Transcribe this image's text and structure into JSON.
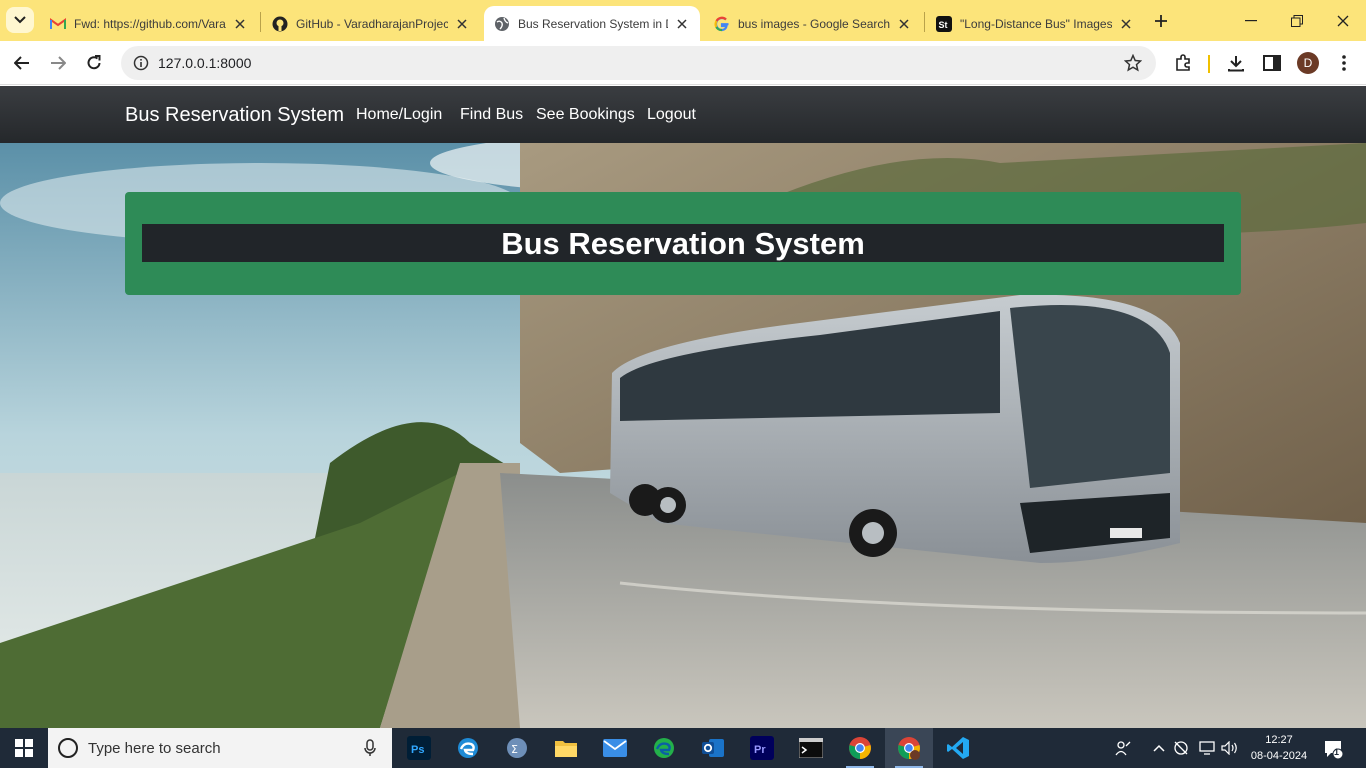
{
  "browser": {
    "tabs": [
      {
        "title": "Fwd: https://github.com/Vara",
        "icon": "gmail-icon"
      },
      {
        "title": "GitHub - VaradharajanProjec",
        "icon": "github-icon"
      },
      {
        "title": "Bus Reservation System in D",
        "icon": "globe-icon",
        "active": true
      },
      {
        "title": "bus images - Google Search",
        "icon": "google-icon"
      },
      {
        "title": "\"Long-Distance Bus\" Images",
        "icon": "shutterstock-icon"
      }
    ],
    "url": "127.0.0.1:8000",
    "profile_initial": "D"
  },
  "navbar": {
    "brand": "Bus Reservation System",
    "links": [
      "Home/Login",
      "Find Bus",
      "See Bookings",
      "Logout"
    ]
  },
  "hero": {
    "title": "Bus Reservation System"
  },
  "taskbar": {
    "search_placeholder": "Type here to search",
    "time": "12:27",
    "date": "08-04-2024",
    "notification_count": "1",
    "apps": [
      "photoshop-icon",
      "edge-icon",
      "calculator-icon",
      "file-explorer-icon",
      "mail-icon",
      "edge-dev-icon",
      "outlook-icon",
      "premiere-icon",
      "terminal-icon",
      "chrome-icon",
      "chrome-profile-icon",
      "vscode-icon"
    ]
  },
  "colors": {
    "tabstrip": "#fce47a",
    "navbar": "#343a40",
    "jumbotron": "#2e8b57",
    "title_bar": "#212529"
  }
}
